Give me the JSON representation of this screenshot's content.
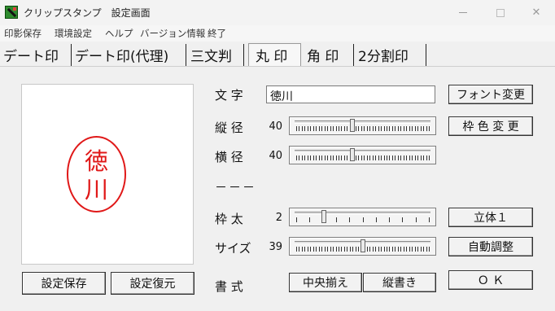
{
  "window": {
    "title": "クリップスタンプ　設定画面",
    "minimize_glyph": "",
    "maximize_glyph": "",
    "close_glyph": "✕"
  },
  "menu": {
    "items": [
      "印影保存",
      "環境設定",
      "ヘルプ",
      "バージョン情報",
      "終了"
    ]
  },
  "tabs": {
    "items": [
      "デート印",
      "デート印(代理)",
      "三文判",
      "丸 印",
      "角 印",
      "2分割印"
    ],
    "active": "丸 印"
  },
  "preview": {
    "stamp_chars": [
      "徳",
      "川"
    ],
    "stamp_color": "#e01818"
  },
  "left_buttons": {
    "save": "設定保存",
    "restore": "設定復元"
  },
  "form": {
    "text_label": "文 字",
    "text_value": "徳川",
    "font_button": "フォント変更",
    "vertical_label": "縦 径",
    "vertical_value": "40",
    "vertical_level": 0.42,
    "frame_color_button": "枠 色 変 更",
    "horizontal_label": "横 径",
    "horizontal_value": "40",
    "horizontal_level": 0.42,
    "separator": "－－－",
    "frame_width_label": "枠 太",
    "frame_width_value": "2",
    "frame_width_level": 0.2,
    "solid_button": "立体１",
    "size_label": "サイズ",
    "size_value": "39",
    "size_level": 0.5,
    "auto_adjust_button": "自動調整",
    "format_label": "書 式",
    "center_button": "中央揃え",
    "vertical_write_button": "縦書き",
    "ok_button": "Ｏ Ｋ"
  }
}
